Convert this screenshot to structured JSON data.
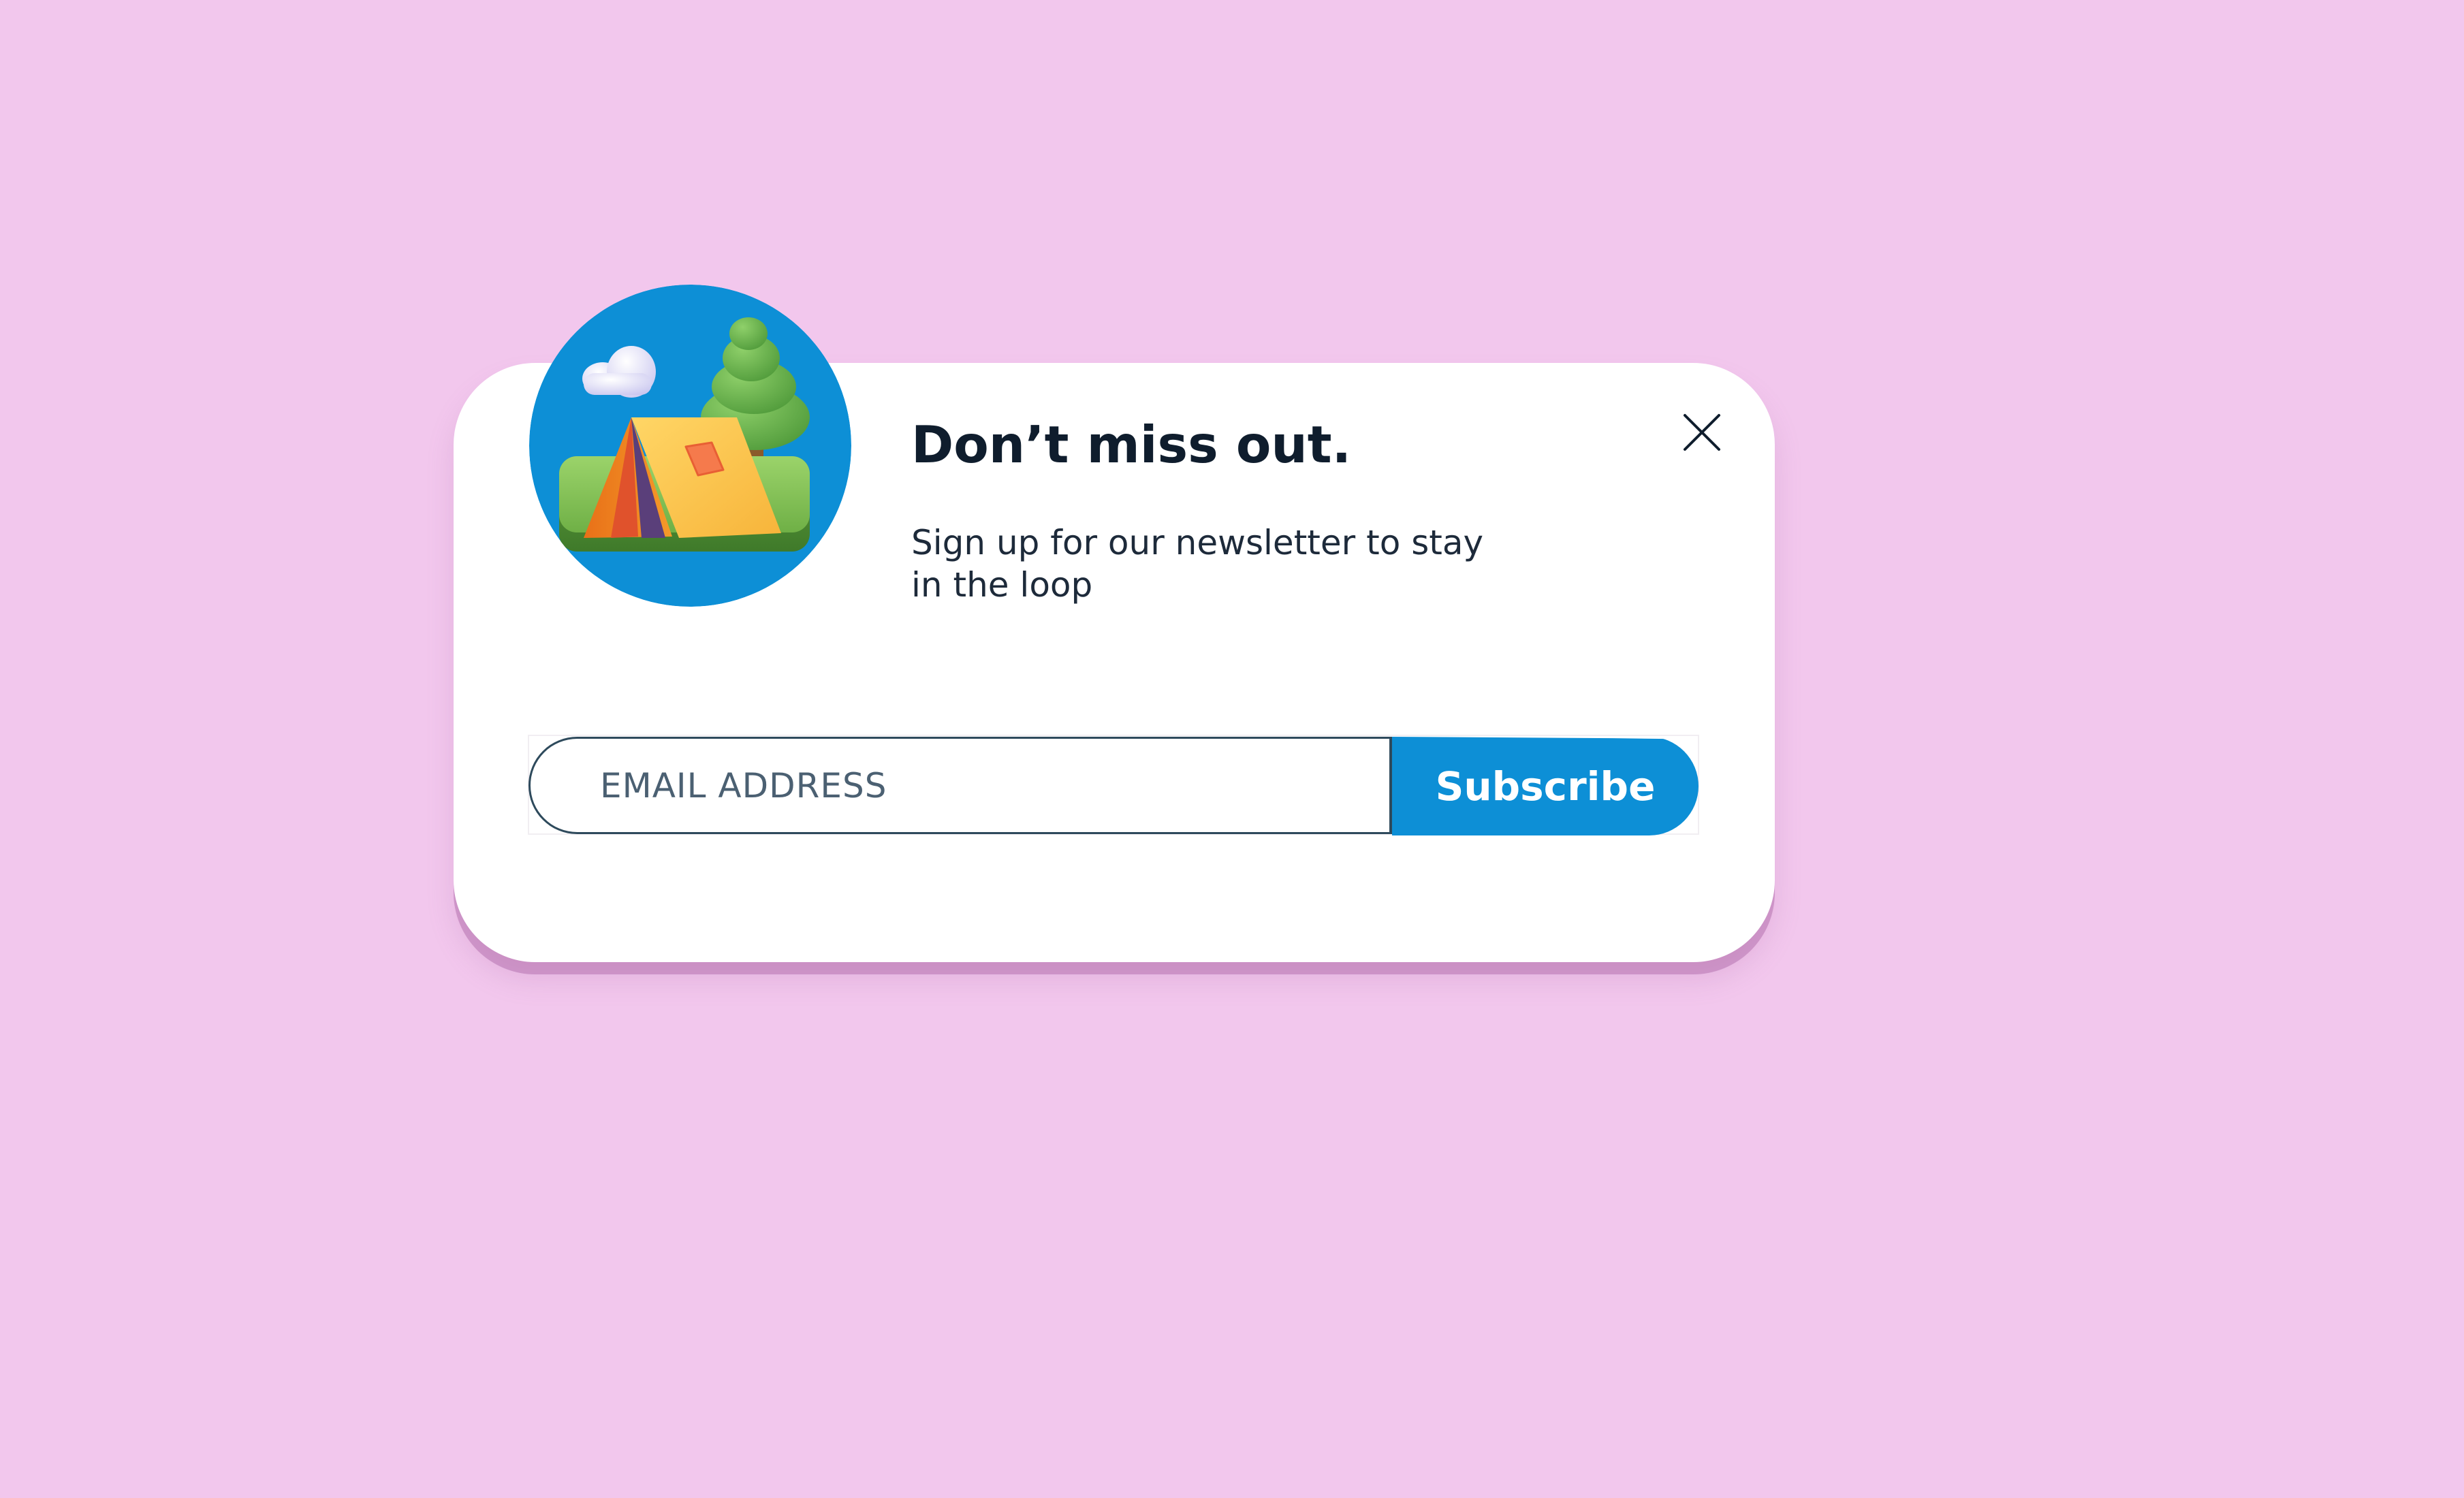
{
  "newsletter": {
    "title": "Don’t miss out.",
    "subtitle": "Sign up for our newsletter to stay in the loop",
    "email_placeholder": "EMAIL ADDRESS",
    "subscribe_label": "Subscribe"
  },
  "icons": {
    "close": "close-icon",
    "illustration": "camping-tent-illustration"
  },
  "colors": {
    "background": "#f2c7ed",
    "card": "#ffffff",
    "accent": "#0d8fd6",
    "title_text": "#0f1d2d",
    "input_border": "#2e4a5c"
  }
}
